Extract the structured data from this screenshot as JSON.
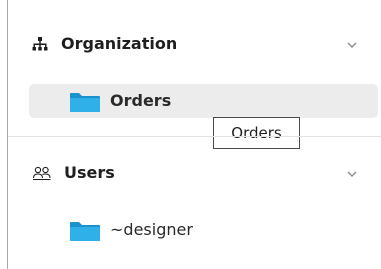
{
  "sections": {
    "organization": {
      "title": "Organization",
      "icon": "org-chart-icon",
      "items": [
        {
          "label": "Orders",
          "icon": "folder-icon",
          "selected": true
        }
      ]
    },
    "users": {
      "title": "Users",
      "icon": "users-icon",
      "items": [
        {
          "label": "~designer",
          "icon": "folder-icon",
          "selected": false
        }
      ]
    }
  },
  "tooltip": {
    "text": "Orders"
  },
  "colors": {
    "folder": "#2fb0e8",
    "folder_dark": "#1a92cc",
    "selected_bg": "#ececec"
  }
}
